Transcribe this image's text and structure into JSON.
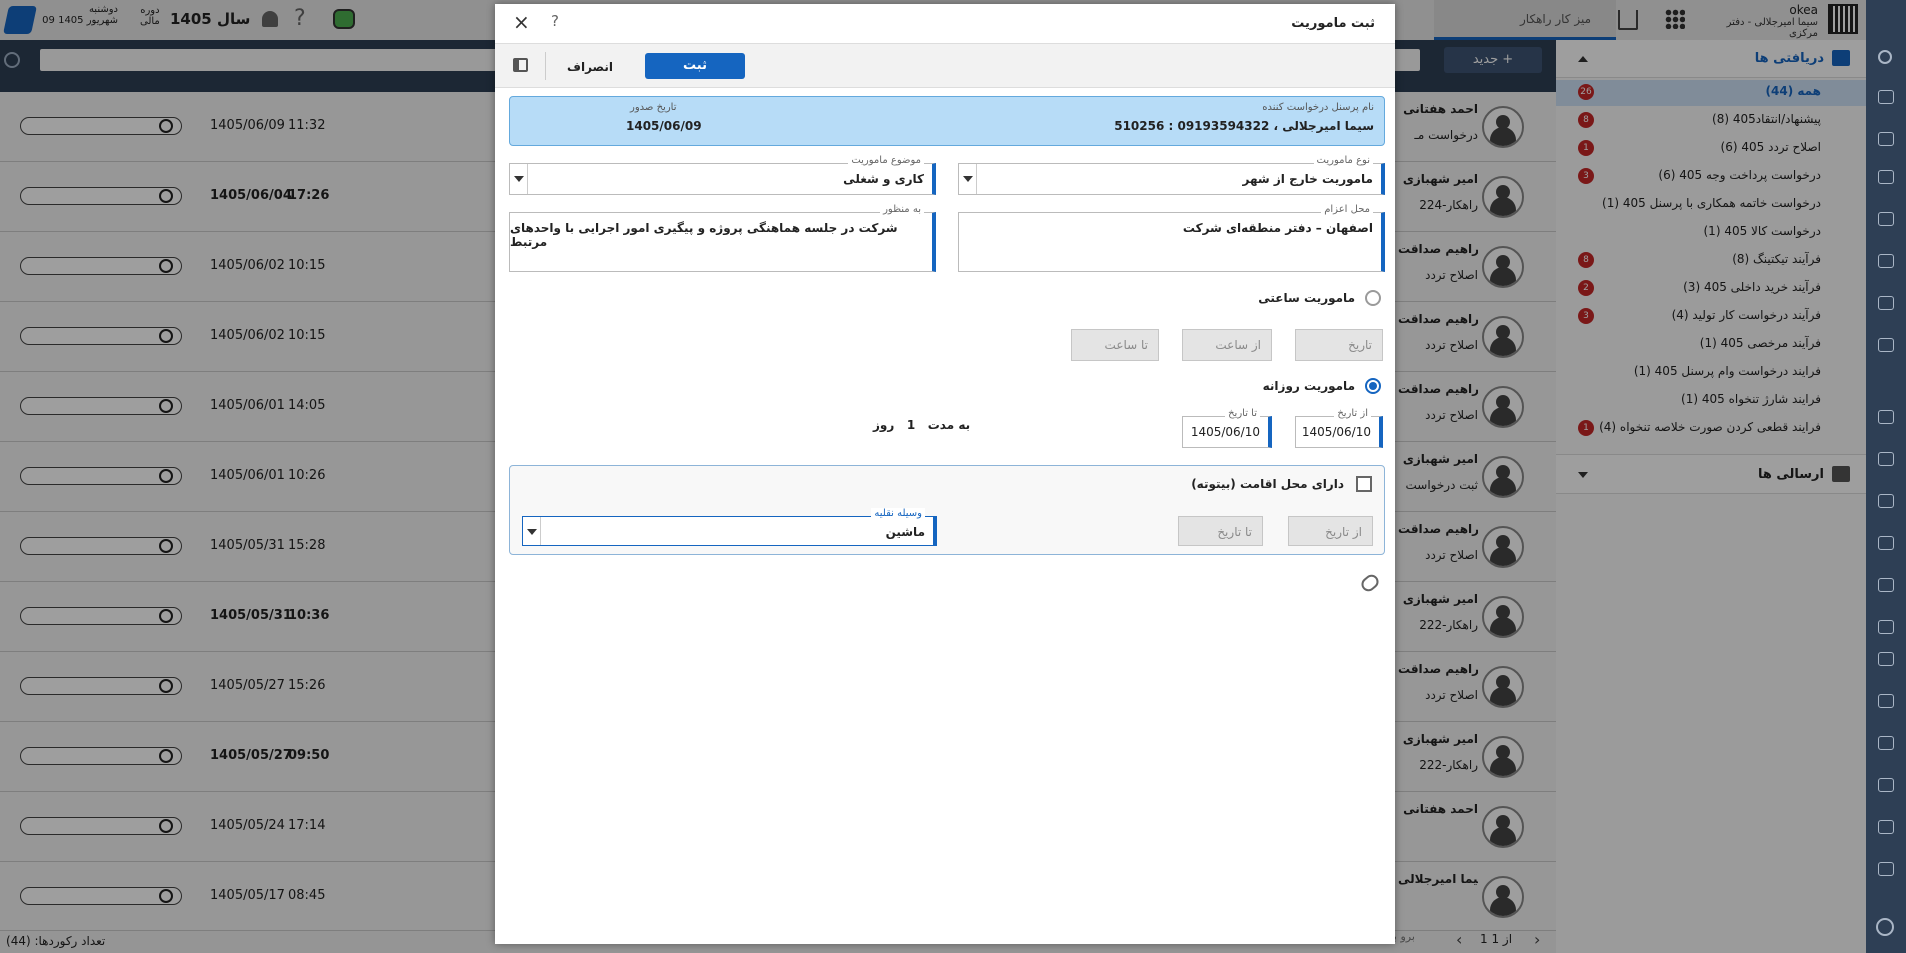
{
  "topbar": {
    "day": "دوشنبه",
    "date": "09 شهریور 1405",
    "period_label_1": "دوره",
    "period_label_2": "مالی",
    "year": "سال 1405",
    "workspace": "میز کار راهکار",
    "company": "okea",
    "user": "سیما امیرجلالی - دفتر مرکزی"
  },
  "left_list": {
    "rows": [
      {
        "date": "1405/06/09",
        "time": "11:32",
        "bold": false,
        "name": "احمد هفتانی",
        "sub": "درخواست مـ"
      },
      {
        "date": "1405/06/04",
        "time": "17:26",
        "bold": true,
        "name": "امیر شهبازی",
        "sub": "224-راهکار"
      },
      {
        "date": "1405/06/02",
        "time": "10:15",
        "bold": false,
        "name": "ابراهیم صداقت",
        "sub": "اصلاح تردد"
      },
      {
        "date": "1405/06/02",
        "time": "10:15",
        "bold": false,
        "name": "ابراهیم صداقت",
        "sub": "اصلاح تردد"
      },
      {
        "date": "1405/06/01",
        "time": "14:05",
        "bold": false,
        "name": "ابراهیم صداقت",
        "sub": "اصلاح تردد"
      },
      {
        "date": "1405/06/01",
        "time": "10:26",
        "bold": false,
        "name": "امیر شهبازی",
        "sub": "ثبت درخواست"
      },
      {
        "date": "1405/05/31",
        "time": "15:28",
        "bold": false,
        "name": "ابراهیم صداقت",
        "sub": "اصلاح تردد"
      },
      {
        "date": "1405/05/31",
        "time": "10:36",
        "bold": true,
        "name": "امیر شهبازی",
        "sub": "222-راهکار"
      },
      {
        "date": "1405/05/27",
        "time": "15:26",
        "bold": false,
        "name": "ابراهیم صداقت",
        "sub": "اصلاح تردد"
      },
      {
        "date": "1405/05/27",
        "time": "09:50",
        "bold": true,
        "name": "امیر شهبازی",
        "sub": "222-راهکار"
      },
      {
        "date": "1405/05/24",
        "time": "17:14",
        "bold": false,
        "name": "احمد هفتانی",
        "sub": ""
      },
      {
        "date": "1405/05/17",
        "time": "08:45",
        "bold": false,
        "name": "سیما امیرجلالی",
        "sub": ""
      }
    ],
    "record_count": "تعداد رکوردها: (44)",
    "pager": "1 از 1",
    "goto": "برو به",
    "new_button": "جدید"
  },
  "right_panel": {
    "inbox_title": "دریافتی ها",
    "outbox_title": "ارسالی ها",
    "items": [
      {
        "label": "همه (44)",
        "badge": "26",
        "selected": true
      },
      {
        "label": "پیشنهاد/انتقاد405 (8)",
        "badge": "8"
      },
      {
        "label": "اصلاح تردد 405 (6)",
        "badge": "1"
      },
      {
        "label": "درخواست پرداخت وجه 405 (6)",
        "badge": "3"
      },
      {
        "label": "درخواست خاتمه همکاری با پرسنل 405 (1)",
        "badge": ""
      },
      {
        "label": "درخواست کالا 405 (1)",
        "badge": ""
      },
      {
        "label": "فرآیند تیکتینگ (8)",
        "badge": "8"
      },
      {
        "label": "فرآیند خرید داخلی 405 (3)",
        "badge": "2"
      },
      {
        "label": "فرآیند درخواست کار تولید (4)",
        "badge": "3"
      },
      {
        "label": "فرآیند مرخصی 405 (1)",
        "badge": ""
      },
      {
        "label": "فرایند درخواست وام پرسنل 405 (1)",
        "badge": ""
      },
      {
        "label": "فرایند شارژ تنخواه 405 (1)",
        "badge": ""
      },
      {
        "label": "فرایند قطعی کردن صورت خلاصه تنخواه (4)",
        "badge": "1"
      }
    ]
  },
  "modal": {
    "title": "ثبت ماموریت",
    "help": "?",
    "close": "×",
    "submit_label": "ثبت",
    "cancel_label": "انصراف",
    "requester_label": "نام پرسنل درخواست کننده",
    "requester_value": "510256 : سیما امیرجلالی ، 09193594322",
    "issue_date_label": "تاریخ صدور",
    "issue_date_value": "1405/06/09",
    "mission_type_label": "نوع ماموریت",
    "mission_type_value": "ماموریت خارج از شهر",
    "mission_subject_label": "موضوع ماموریت",
    "mission_subject_value": "کاری و شغلی",
    "destination_label": "محل اعزام",
    "destination_value": "اصفهان – دفتر منطقه‌ای شرکت",
    "purpose_label": "به منظور",
    "purpose_value": "شرکت در جلسه هماهنگی پروژه و پیگیری امور اجرایی با واحدهای مرتبط",
    "hourly_label": "ماموریت ساعتی",
    "hourly_date_placeholder": "تاریخ",
    "hourly_from_placeholder": "از ساعت",
    "hourly_to_placeholder": "تا ساعت",
    "daily_label": "ماموریت روزانه",
    "from_date_label": "از تاریخ",
    "from_date_value": "1405/06/10",
    "to_date_label": "تا تاریخ",
    "to_date_value": "1405/06/10",
    "duration_prefix": "به مدت",
    "duration_value": "1",
    "duration_unit": "روز",
    "accommodation_label": "دارای محل اقامت (بیتوته)",
    "acc_from_placeholder": "از تاریخ",
    "acc_to_placeholder": "تا تاریخ",
    "vehicle_label": "وسیله نقلیه",
    "vehicle_value": "ماشین"
  }
}
